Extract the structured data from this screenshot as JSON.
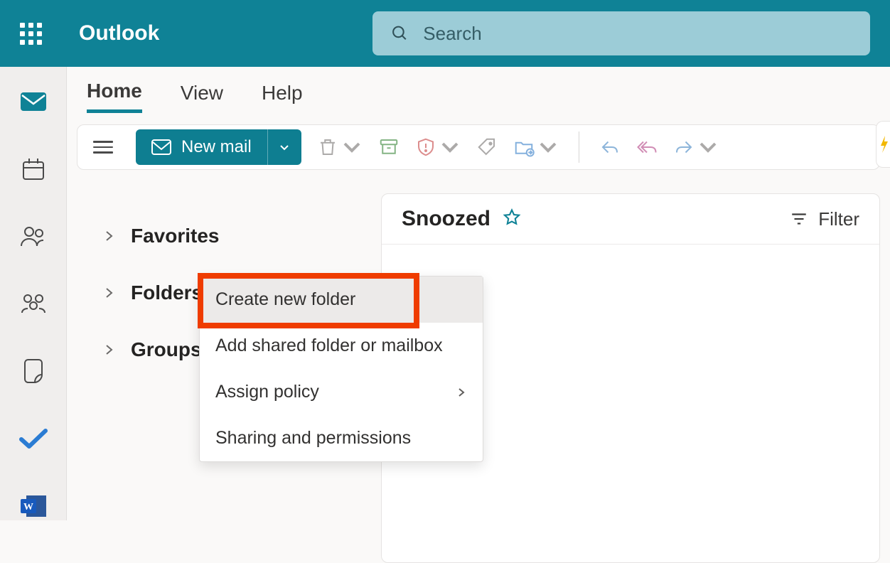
{
  "banner": {
    "brand": "Outlook",
    "search_placeholder": "Search"
  },
  "tabs": {
    "home": "Home",
    "view": "View",
    "help": "Help"
  },
  "toolbar": {
    "new_mail": "New mail"
  },
  "folders": {
    "favorites": "Favorites",
    "folders": "Folders",
    "groups": "Groups"
  },
  "context": {
    "create_folder": "Create new folder",
    "add_shared": "Add shared folder or mailbox",
    "assign_policy": "Assign policy",
    "sharing": "Sharing and permissions"
  },
  "pane": {
    "title": "Snoozed",
    "filter": "Filter"
  }
}
